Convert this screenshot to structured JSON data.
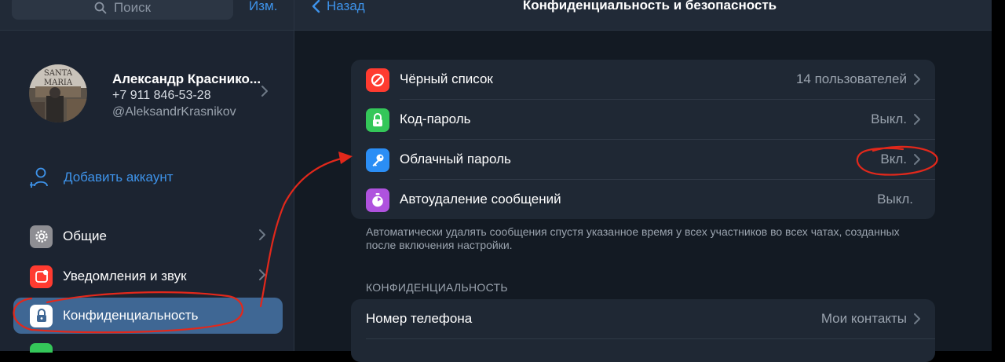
{
  "sidebar": {
    "search_placeholder": "Поиск",
    "edit_label": "Изм.",
    "profile": {
      "name": "Александр Краснико...",
      "phone": "+7 911 846-53-28",
      "username": "@AleksandrKrasnikov",
      "avatar_text_1": "SANTA",
      "avatar_text_2": "MARIA"
    },
    "add_account_label": "Добавить аккаунт",
    "items": [
      {
        "label": "Общие",
        "icon": "gear-icon",
        "color": "#8e8e93"
      },
      {
        "label": "Уведомления и звук",
        "icon": "notification-icon",
        "color": "#ff3b30"
      },
      {
        "label": "Конфиденциальность",
        "icon": "lock-icon",
        "color": "#ffffff"
      }
    ]
  },
  "header": {
    "back_label": "Назад",
    "title": "Конфиденциальность и безопасность"
  },
  "security_group": {
    "rows": [
      {
        "label": "Чёрный список",
        "value": "14 пользователей",
        "icon": "block-icon",
        "color": "#ff3b30"
      },
      {
        "label": "Код-пароль",
        "value": "Выкл.",
        "icon": "lock-icon",
        "color": "#34c759"
      },
      {
        "label": "Облачный пароль",
        "value": "Вкл.",
        "icon": "key-icon",
        "color": "#2b8ef5"
      },
      {
        "label": "Автоудаление сообщений",
        "value": "Выкл.",
        "icon": "timer-icon",
        "color": "#af52de"
      }
    ],
    "note": "Автоматически удалять сообщения спустя указанное время у всех участников во всех чатах, созданных после включения настройки."
  },
  "privacy_section": {
    "header": "КОНФИДЕНЦИАЛЬНОСТЬ",
    "rows": [
      {
        "label": "Номер телефона",
        "value": "Мои контакты"
      }
    ]
  },
  "colors": {
    "accent": "#3e93ea",
    "annotation": "#e2281b",
    "active_item": "#3f6794"
  }
}
